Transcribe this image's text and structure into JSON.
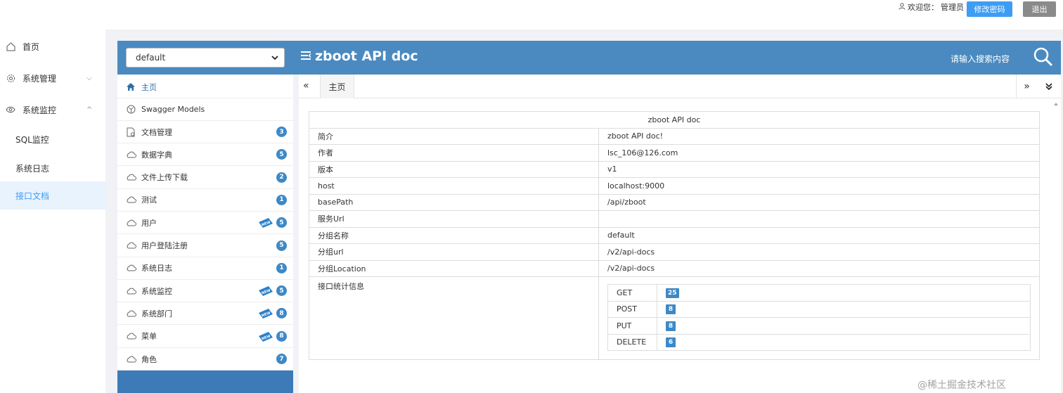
{
  "topbar": {
    "welcome_prefix": "欢迎您：",
    "username": "管理员",
    "change_password": "修改密码",
    "logout": "退出"
  },
  "sysmenu": {
    "home": "首页",
    "system_management": "系统管理",
    "system_monitor": "系统监控",
    "sql_monitor": "SQL监控",
    "system_log": "系统日志",
    "api_docs": "接口文档"
  },
  "header": {
    "group_selected": "default",
    "title": "zboot API doc",
    "search_placeholder": "请输入搜索内容"
  },
  "nav": {
    "home": "主页",
    "models": "Swagger Models",
    "items": [
      {
        "label": "文档管理",
        "count": "3",
        "new": false
      },
      {
        "label": "数据字典",
        "count": "5",
        "new": false
      },
      {
        "label": "文件上传下载",
        "count": "2",
        "new": false
      },
      {
        "label": "测试",
        "count": "1",
        "new": false
      },
      {
        "label": "用户",
        "count": "5",
        "new": true
      },
      {
        "label": "用户登陆注册",
        "count": "5",
        "new": false
      },
      {
        "label": "系统日志",
        "count": "1",
        "new": false
      },
      {
        "label": "系统监控",
        "count": "5",
        "new": true
      },
      {
        "label": "系统部门",
        "count": "8",
        "new": true
      },
      {
        "label": "菜单",
        "count": "8",
        "new": true
      },
      {
        "label": "角色",
        "count": "7",
        "new": false
      }
    ]
  },
  "tabs": {
    "home": "主页"
  },
  "info": {
    "title": "zboot API doc",
    "rows": [
      {
        "key": "简介",
        "value": "zboot API doc!"
      },
      {
        "key": "作者",
        "value": "lsc_106@126.com"
      },
      {
        "key": "版本",
        "value": "v1"
      },
      {
        "key": "host",
        "value": "localhost:9000"
      },
      {
        "key": "basePath",
        "value": "/api/zboot"
      },
      {
        "key": "服务Url",
        "value": ""
      },
      {
        "key": "分组名称",
        "value": "default"
      },
      {
        "key": "分组url",
        "value": "/v2/api-docs"
      },
      {
        "key": "分组Location",
        "value": "/v2/api-docs"
      }
    ],
    "stats_label": "接口统计信息",
    "stats": [
      {
        "method": "GET",
        "count": "25"
      },
      {
        "method": "POST",
        "count": "8"
      },
      {
        "method": "PUT",
        "count": "8"
      },
      {
        "method": "DELETE",
        "count": "6"
      }
    ]
  },
  "watermark": "@稀土掘金技术社区",
  "colors": {
    "header_blue": "#4a8ac0",
    "badge_blue": "#3d89c7",
    "button_blue": "#3d9df3",
    "logout_gray": "#8a8a8a",
    "active_bg": "#e9f3fd"
  }
}
